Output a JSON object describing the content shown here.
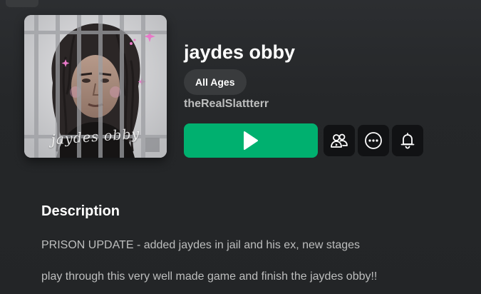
{
  "game": {
    "title": "jaydes obby",
    "age_rating": "All Ages",
    "creator": "theRealSlattterr",
    "thumbnail": {
      "caption": "jaydes obby",
      "icon": "game-thumbnail-portrait-behind-bars"
    }
  },
  "actions": {
    "play_icon": "play-icon",
    "party_icon": "party-icon",
    "more_icon": "more-options-icon",
    "notify_icon": "notification-bell-icon"
  },
  "description": {
    "heading": "Description",
    "lines": [
      "PRISON UPDATE - added jaydes in jail and his ex, new stages",
      "play through this very well made game and finish the jaydes obby!!"
    ]
  },
  "colors": {
    "background": "#232527",
    "play_button": "#00b06f",
    "icon_button": "#111214",
    "pill": "#393b3d",
    "muted_text": "#bdbebe"
  }
}
